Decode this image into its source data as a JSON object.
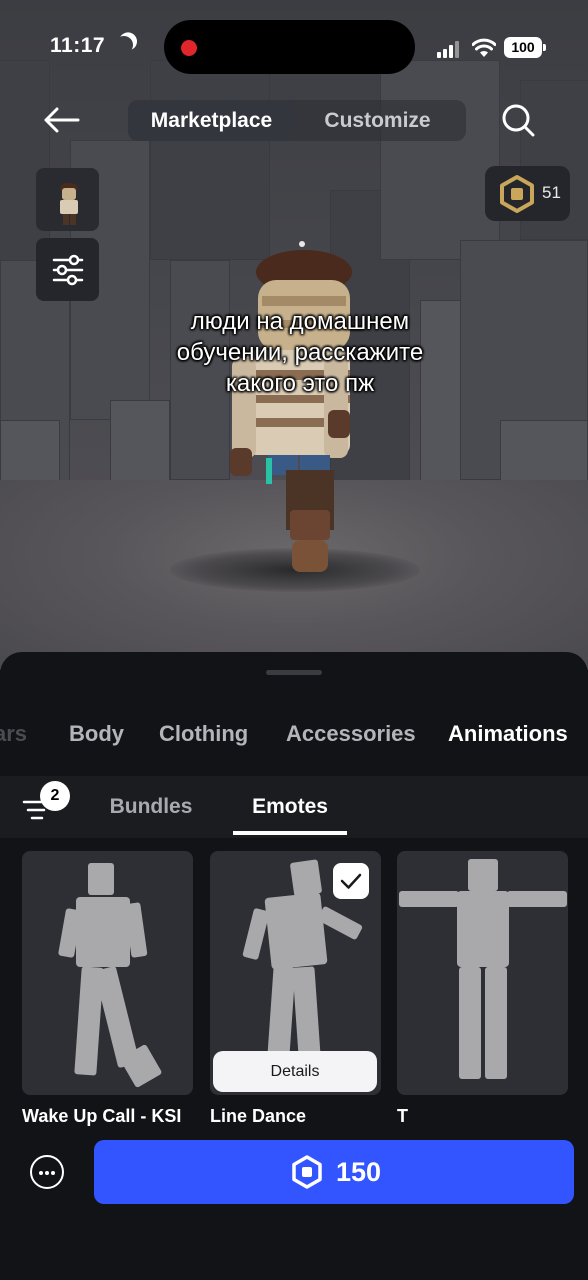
{
  "status_bar": {
    "time": "11:17",
    "battery": "100"
  },
  "nav": {
    "tabs": [
      {
        "label": "Marketplace",
        "active": true
      },
      {
        "label": "Customize",
        "active": false
      }
    ]
  },
  "wallet": {
    "robux": "51"
  },
  "overlay_caption": {
    "lines": [
      "люди на домашнем",
      "обучении, расскажите",
      "какого это пж"
    ]
  },
  "categories": [
    {
      "label": "ars",
      "state": "faded"
    },
    {
      "label": "Body",
      "state": "inactive"
    },
    {
      "label": "Clothing",
      "state": "inactive"
    },
    {
      "label": "Accessories",
      "state": "inactive"
    },
    {
      "label": "Animations",
      "state": "active"
    }
  ],
  "subtabs": {
    "sort_badge": "2",
    "items": [
      {
        "label": "Bundles",
        "active": false
      },
      {
        "label": "Emotes",
        "active": true
      }
    ]
  },
  "items": [
    {
      "title": "Wake Up Call - KSI",
      "selected": false
    },
    {
      "title": "Line Dance",
      "selected": true,
      "action": "Details"
    },
    {
      "title": "T",
      "selected": false
    }
  ],
  "purchase": {
    "price": "150"
  },
  "colors": {
    "accent_blue": "#3355ff",
    "sheet_bg": "#121316",
    "card_bg": "#2e2f35",
    "recording_red": "#e0252b"
  }
}
